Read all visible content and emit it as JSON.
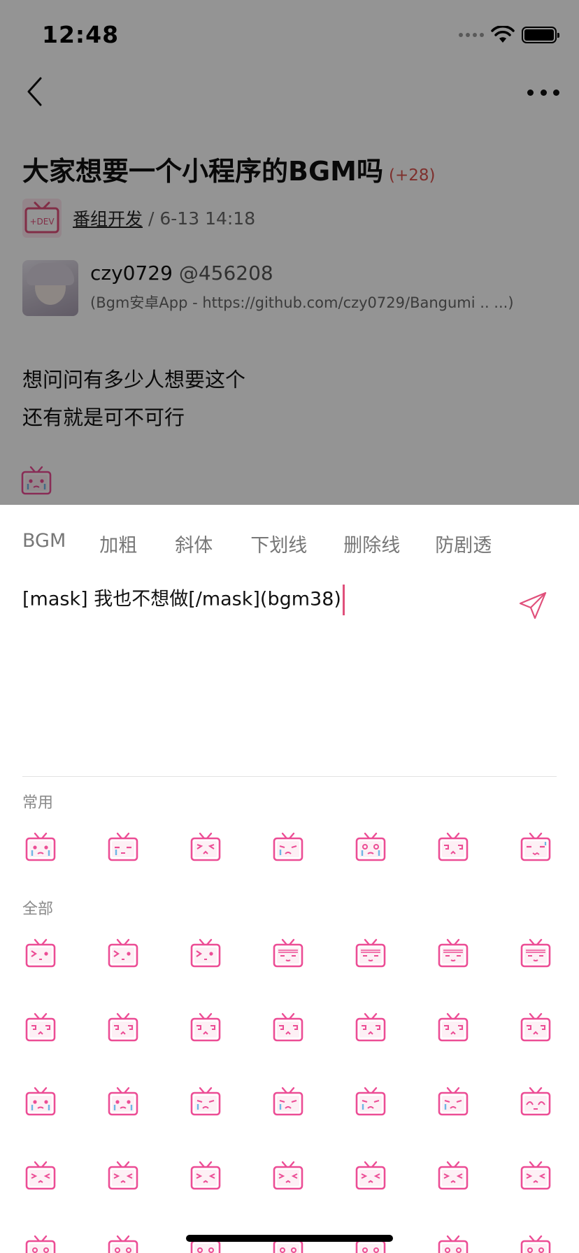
{
  "status_bar": {
    "time": "12:48"
  },
  "nav": {
    "back_icon": "chevron-left-icon",
    "more_icon": "ellipsis-icon"
  },
  "topic": {
    "title": "大家想要一个小程序的BGM吗",
    "reply_count": "(+28)",
    "group_name": "番组开发",
    "time": "/ 6-13 14:18",
    "group_icon_text": "+DEV"
  },
  "author": {
    "name": "czy0729",
    "uid": "@456208",
    "sign": "(Bgm安卓App - https://github.com/czy0729/Bangumi .. ...)"
  },
  "content": {
    "line1": "想问问有多少人想要这个",
    "line2": "还有就是可不可行"
  },
  "toolbar": {
    "bgm": "BGM",
    "bold": "加粗",
    "italic": "斜体",
    "underline": "下划线",
    "strike": "删除线",
    "spoiler": "防剧透"
  },
  "editor": {
    "value": "[mask] 我也不想做[/mask](bgm38)"
  },
  "sections": {
    "common": "常用",
    "all": "全部"
  },
  "emoji": {
    "common": [
      "bgm-cry",
      "bgm-tear",
      "bgm-shy",
      "bgm-sad",
      "bgm-sob",
      "bgm-dizzy",
      "bgm-sweat"
    ],
    "all": [
      "bgm-wink",
      "bgm-wink",
      "bgm-wink",
      "bgm-sleep",
      "bgm-sleep",
      "bgm-sleep",
      "bgm-sleep",
      "bgm-dizzy",
      "bgm-dizzy",
      "bgm-dizzy",
      "bgm-dizzy",
      "bgm-dizzy",
      "bgm-dizzy",
      "bgm-dizzy",
      "bgm-cry",
      "bgm-cry",
      "bgm-sad",
      "bgm-sad",
      "bgm-sad",
      "bgm-sad",
      "bgm-angry",
      "bgm-squint",
      "bgm-squint",
      "bgm-squint",
      "bgm-squint",
      "bgm-squint",
      "bgm-squint",
      "bgm-squint",
      "bgm-neutral",
      "bgm-neutral",
      "bgm-neutral",
      "bgm-neutral",
      "bgm-neutral",
      "bgm-neutral",
      "bgm-neutral"
    ]
  },
  "colors": {
    "accent": "#e0507b",
    "reply_count": "#d9534f",
    "emoji_pink": "#ec4d95"
  }
}
